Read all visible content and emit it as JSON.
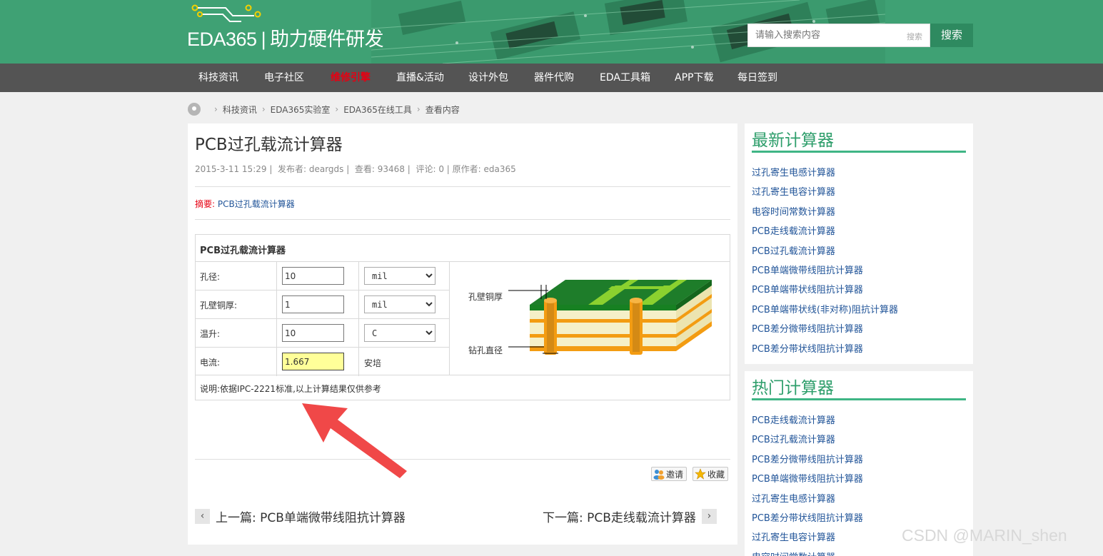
{
  "site": {
    "logo_text": "EDA365",
    "slogan": "助力硬件研发"
  },
  "search": {
    "placeholder": "请输入搜索内容",
    "hint": "搜索",
    "button_label": "搜索"
  },
  "nav": {
    "items": [
      "科技资讯",
      "电子社区",
      "维修引擎",
      "直播&活动",
      "设计外包",
      "器件代购",
      "EDA工具箱",
      "APP下载",
      "每日签到"
    ],
    "highlight_color": "#e60012"
  },
  "breadcrumb": [
    "科技资讯",
    "EDA365实验室",
    "EDA365在线工具",
    "查看内容"
  ],
  "article": {
    "title": "PCB过孔载流计算器",
    "meta": {
      "date": "2015-3-11 15:29",
      "publisher": "发布者: deargds",
      "views": "查看: 93468",
      "comments": "评论: 0",
      "author": "原作者: eda365"
    },
    "summary_label": "摘要:",
    "summary_text": "PCB过孔载流计算器"
  },
  "calculator": {
    "title": "PCB过孔载流计算器",
    "rows": [
      {
        "label": "孔径:",
        "value": "10",
        "unit": "mil"
      },
      {
        "label": "孔壁铜厚:",
        "value": "1",
        "unit": "mil"
      },
      {
        "label": "温升:",
        "value": "10",
        "unit": "C"
      },
      {
        "label": "电流:",
        "value": "1.667",
        "unit": "安培"
      }
    ],
    "diagram_labels": {
      "wall": "孔壁铜厚",
      "drill": "钻孔直径"
    },
    "note": "说明:依据IPC-2221标准,以上计算结果仅供参考"
  },
  "actions": {
    "invite": "邀请",
    "favorite": "收藏"
  },
  "pager": {
    "prev": "上一篇:  PCB单端微带线阻抗计算器",
    "next": "下一篇:  PCB走线载流计算器",
    "prev_icon": "‹",
    "next_icon": "›"
  },
  "sidebar": {
    "latest": {
      "title": "最新计算器",
      "items": [
        "过孔寄生电感计算器",
        "过孔寄生电容计算器",
        "电容时间常数计算器",
        "PCB走线载流计算器",
        "PCB过孔载流计算器",
        "PCB单端微带线阻抗计算器",
        "PCB单端带状线阻抗计算器",
        "PCB单端带状线(非对称)阻抗计算器",
        "PCB差分微带线阻抗计算器",
        "PCB差分带状线阻抗计算器"
      ]
    },
    "hot": {
      "title": "热门计算器",
      "items": [
        "PCB走线载流计算器",
        "PCB过孔载流计算器",
        "PCB差分微带线阻抗计算器",
        "PCB单端微带线阻抗计算器",
        "过孔寄生电感计算器",
        "PCB差分带状线阻抗计算器",
        "过孔寄生电容计算器",
        "电容时间常数计算器"
      ]
    }
  },
  "watermark": "CSDN @MARIN_shen",
  "colors": {
    "header": "#3fa174",
    "nav": "#545454",
    "accent": "#3fb585",
    "link": "#225599",
    "arrow": "#f04848"
  }
}
